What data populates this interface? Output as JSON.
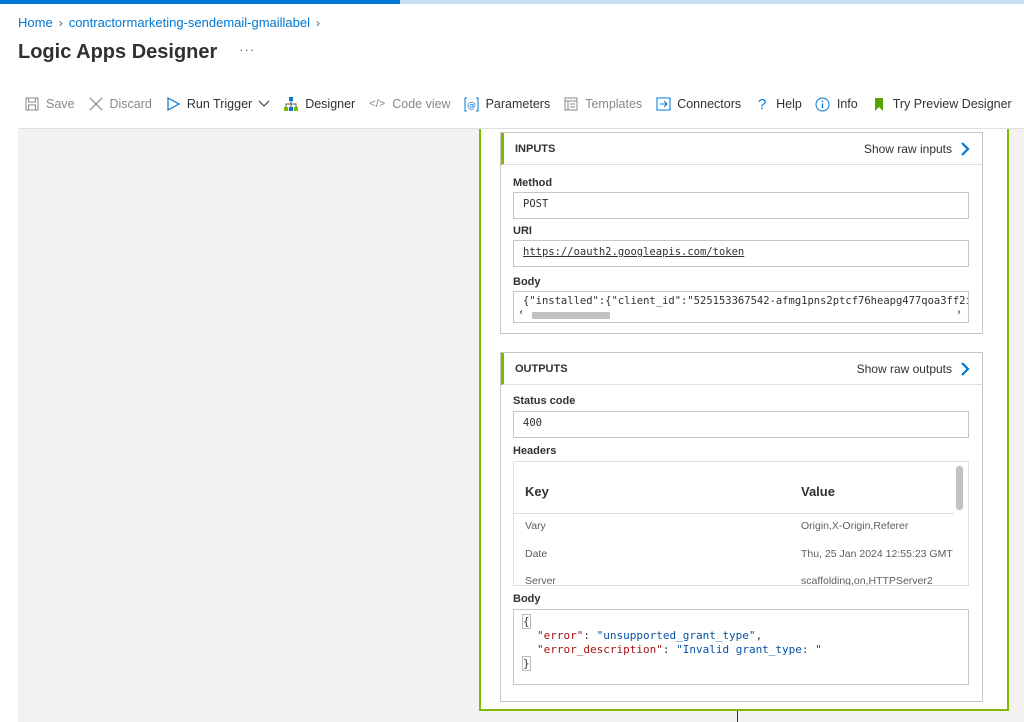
{
  "breadcrumb": {
    "home": "Home",
    "resource": "contractormarketing-sendemail-gmaillabel"
  },
  "page": {
    "title": "Logic Apps Designer",
    "more": "···"
  },
  "toolbar": {
    "save": "Save",
    "discard": "Discard",
    "run_trigger": "Run Trigger",
    "designer": "Designer",
    "code_view": "Code view",
    "parameters": "Parameters",
    "templates": "Templates",
    "connectors": "Connectors",
    "help": "Help",
    "info": "Info",
    "try_preview": "Try Preview Designer"
  },
  "inputs": {
    "title": "INPUTS",
    "raw_link": "Show raw inputs",
    "method_label": "Method",
    "method_value": "POST",
    "uri_label": "URI",
    "uri_value": "https://oauth2.googleapis.com/token",
    "body_label": "Body",
    "body_value": "{\"installed\":{\"client_id\":\"525153367542-afmg1pns2ptcf76heapg477qoa3ff2i"
  },
  "outputs": {
    "title": "OUTPUTS",
    "raw_link": "Show raw outputs",
    "status_label": "Status code",
    "status_value": "400",
    "headers_label": "Headers",
    "headers_columns": {
      "key": "Key",
      "value": "Value"
    },
    "headers_rows": [
      {
        "key": "Vary",
        "value": "Origin,X-Origin,Referer"
      },
      {
        "key": "Date",
        "value": "Thu, 25 Jan 2024 12:55:23 GMT"
      },
      {
        "key": "Server",
        "value": "scaffolding,on,HTTPServer2"
      }
    ],
    "body_label": "Body",
    "body_json": {
      "open": "{",
      "close": "}",
      "error_key": "\"error\"",
      "error_value": "\"unsupported_grant_type\"",
      "desc_key": "\"error_description\"",
      "desc_value": "\"Invalid grant_type: \""
    }
  },
  "colors": {
    "accent": "#0078d4",
    "success_border": "#7fba00",
    "canvas": "#f3f2f1"
  }
}
